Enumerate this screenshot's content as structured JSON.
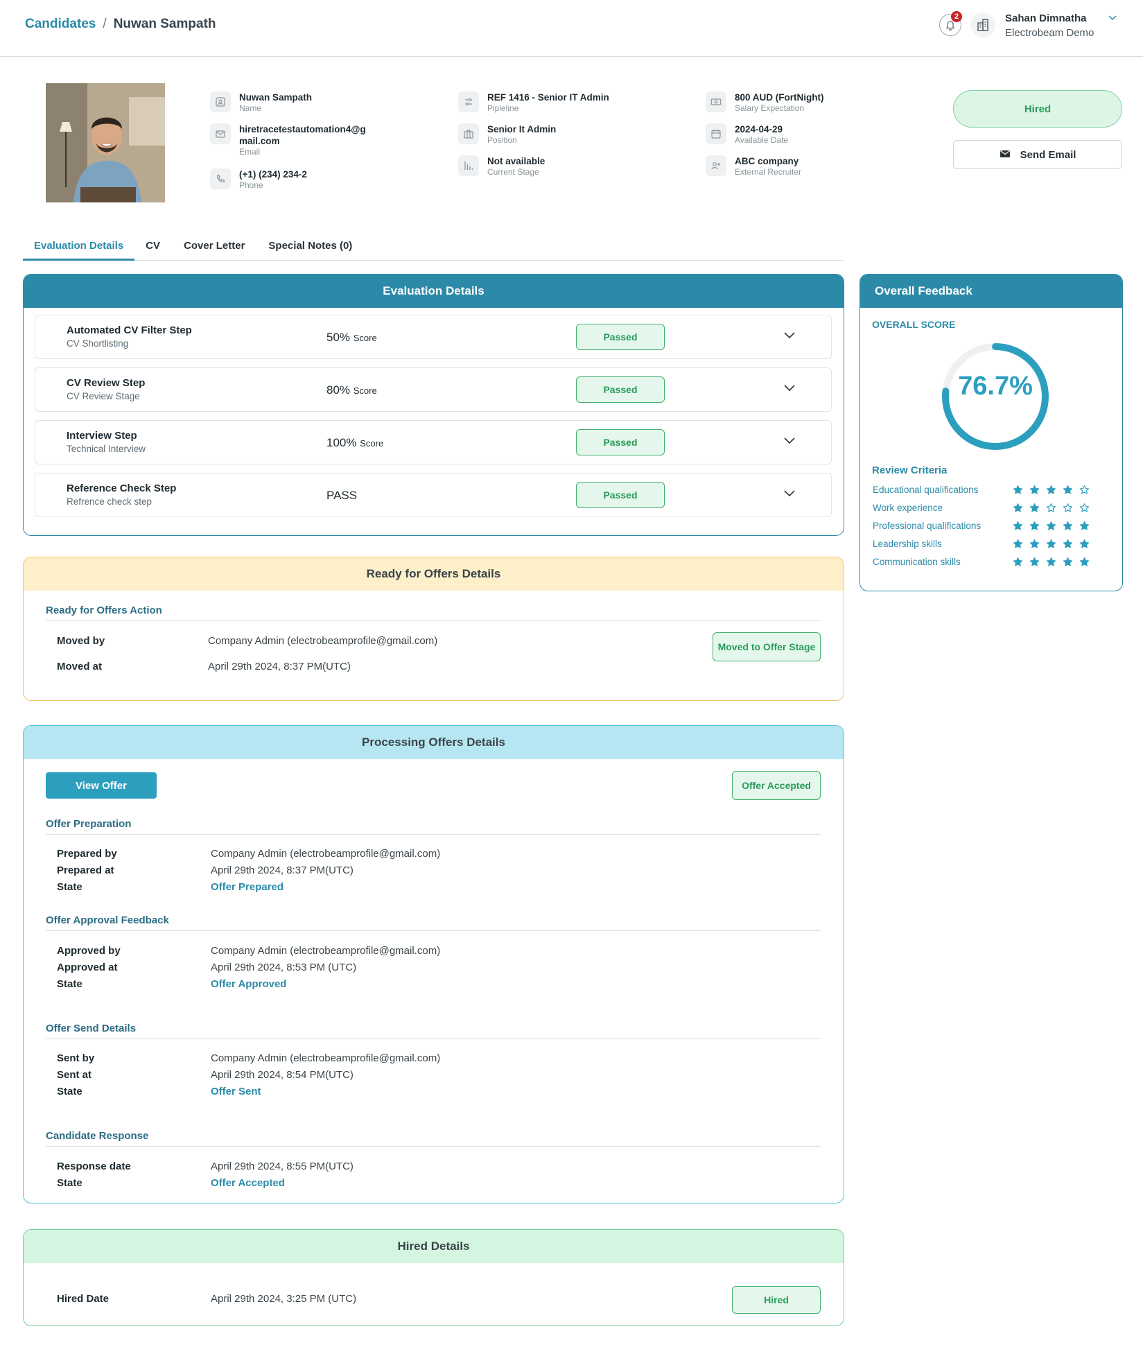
{
  "header": {
    "breadcrumb_root": "Candidates",
    "breadcrumb_sep": "/",
    "breadcrumb_current": "Nuwan Sampath",
    "notification_count": "2",
    "user_name": "Sahan Dimnatha",
    "user_org": "Electrobeam Demo"
  },
  "profile": {
    "name": "Nuwan Sampath",
    "name_label": "Name",
    "email_line1": "hiretracetestautomation4@g",
    "email_line2": "mail.com",
    "email_label": "Email",
    "phone": "(+1) (234) 234-2",
    "phone_label": "Phone",
    "pipeline": "REF 1416 - Senior IT Admin",
    "pipeline_label": "Pipleline",
    "position": "Senior It Admin",
    "position_label": "Position",
    "stage": "Not available",
    "stage_label": "Current Stage",
    "salary": "800 AUD (FortNight)",
    "salary_label": "Salary Expectation",
    "available_date": "2024-04-29",
    "available_label": "Available Date",
    "recruiter": "ABC company",
    "recruiter_label": "External Recruiter",
    "status_button": "Hired",
    "send_email": "Send Email"
  },
  "tabs": [
    "Evaluation Details",
    "CV",
    "Cover Letter",
    "Special Notes (0)"
  ],
  "evaluation": {
    "title": "Evaluation Details",
    "steps": [
      {
        "title": "Automated CV Filter Step",
        "sub": "CV Shortlisting",
        "score": "50%",
        "score_unit": "Score",
        "status": "Passed"
      },
      {
        "title": "CV Review Step",
        "sub": "CV Review Stage",
        "score": "80%",
        "score_unit": "Score",
        "status": "Passed"
      },
      {
        "title": "Interview Step",
        "sub": "Technical Interview",
        "score": "100%",
        "score_unit": "Score",
        "status": "Passed"
      },
      {
        "title": "Reference Check Step",
        "sub": "Refrence check step",
        "score": "PASS",
        "score_unit": "",
        "status": "Passed"
      }
    ]
  },
  "feedback": {
    "title": "Overall Feedback",
    "score_label": "OVERALL SCORE",
    "score": "76.7%",
    "score_fraction": 0.767,
    "criteria_title": "Review Criteria",
    "criteria": [
      {
        "name": "Educational qualifications",
        "stars": 4
      },
      {
        "name": "Work experience",
        "stars": 2
      },
      {
        "name": "Professional qualifications",
        "stars": 5
      },
      {
        "name": "Leadership skills",
        "stars": 5
      },
      {
        "name": "Communication skills",
        "stars": 5
      }
    ],
    "accent": "#2c9fbf"
  },
  "ready": {
    "title": "Ready for Offers Details",
    "section": "Ready for Offers Action",
    "moved_by_label": "Moved by",
    "moved_by": "Company Admin (electrobeamprofile@gmail.com)",
    "moved_at_label": "Moved at",
    "moved_at": "April 29th 2024, 8:37 PM(UTC)",
    "badge": "Moved to Offer Stage"
  },
  "processing": {
    "title": "Processing Offers Details",
    "view_offer": "View Offer",
    "badge": "Offer Accepted",
    "preparation": {
      "title": "Offer Preparation",
      "by_label": "Prepared by",
      "by": "Company Admin (electrobeamprofile@gmail.com)",
      "at_label": "Prepared at",
      "at": "April 29th 2024, 8:37 PM(UTC)",
      "state_label": "State",
      "state": "Offer Prepared"
    },
    "approval": {
      "title": "Offer Approval Feedback",
      "by_label": "Approved by",
      "by": "Company Admin (electrobeamprofile@gmail.com)",
      "at_label": "Approved at",
      "at": "April 29th 2024, 8:53 PM (UTC)",
      "state_label": "State",
      "state": "Offer Approved"
    },
    "send": {
      "title": "Offer Send Details",
      "by_label": "Sent by",
      "by": "Company Admin (electrobeamprofile@gmail.com)",
      "at_label": "Sent at",
      "at": "April 29th 2024, 8:54 PM(UTC)",
      "state_label": "State",
      "state": "Offer Sent"
    },
    "response": {
      "title": "Candidate Response",
      "date_label": "Response date",
      "date": "April 29th 2024, 8:55 PM(UTC)",
      "state_label": "State",
      "state": "Offer Accepted"
    }
  },
  "hired": {
    "title": "Hired Details",
    "date_label": "Hired Date",
    "date": "April 29th 2024, 3:25 PM (UTC)",
    "badge": "Hired"
  }
}
